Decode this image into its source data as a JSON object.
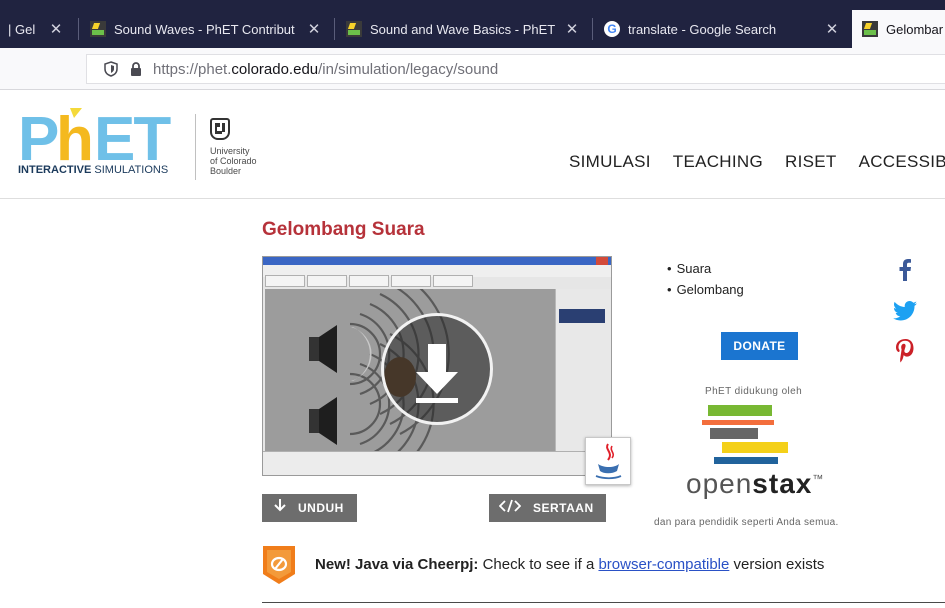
{
  "browser": {
    "tabs": [
      {
        "title": "| Gel",
        "active": false,
        "icon": "none"
      },
      {
        "title": "Sound Waves - PhET Contribut",
        "active": false,
        "icon": "phet-icon"
      },
      {
        "title": "Sound and Wave Basics - PhET",
        "active": false,
        "icon": "phet-icon"
      },
      {
        "title": "translate - Google Search",
        "active": false,
        "icon": "google-icon"
      },
      {
        "title": "Gelombar",
        "active": true,
        "icon": "phet-icon"
      }
    ],
    "close_glyph": "✕",
    "url_prefix": "https://phet.",
    "url_domain": "colorado.edu",
    "url_path": "/in/simulation/legacy/sound"
  },
  "header": {
    "logo_text": "PhET",
    "logo_sub_bold": "INTERACTIVE",
    "logo_sub": " SIMULATIONS",
    "cu_line1": "University",
    "cu_line2": "of Colorado",
    "cu_line3": "Boulder",
    "nav": [
      "SIMULASI",
      "TEACHING",
      "RISET",
      "ACCESSIBI"
    ]
  },
  "sim": {
    "title": "Gelombang Suara",
    "download_label": "UNDUH",
    "embed_label": "SERTAAN",
    "topics": [
      "Suara",
      "Gelombang"
    ]
  },
  "sidebar": {
    "donate_label": "DONATE",
    "support_text": "PhET didukung oleh",
    "openstax_light": "open",
    "openstax_bold": "stax",
    "openstax_tm": "™",
    "openstax_sub": "dan para pendidik seperti Anda semua."
  },
  "notice": {
    "bold": "New! Java via Cheerpj:",
    "text_before": " Check to see if a ",
    "link": "browser-compatible",
    "text_after": " version exists"
  },
  "colors": {
    "title_red": "#b6323a",
    "donate_blue": "#1b75d0",
    "tab_bar": "#202340",
    "facebook": "#3b5998",
    "twitter": "#1da1f2",
    "pinterest": "#cb2027"
  }
}
